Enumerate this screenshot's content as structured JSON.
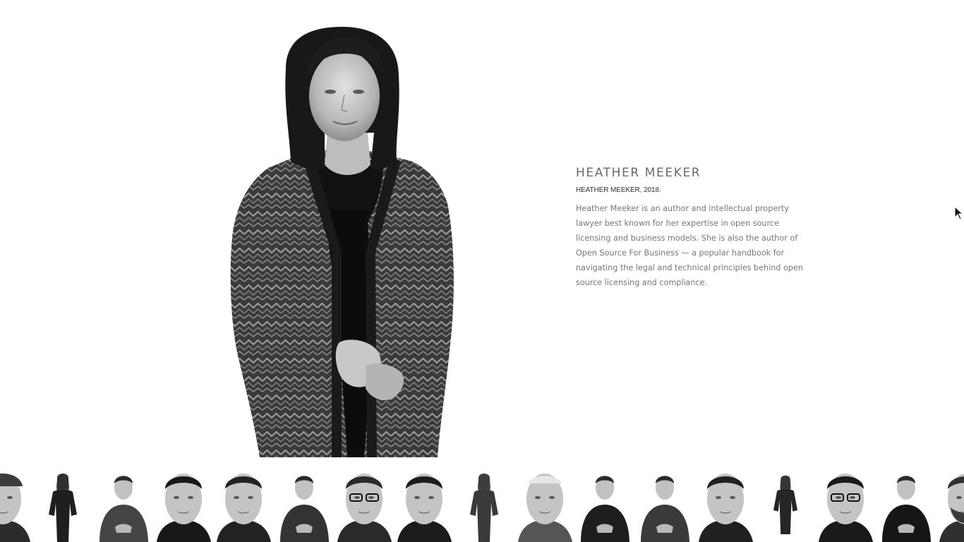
{
  "person": {
    "name": "HEATHER MEEKER",
    "caption": "HEATHER MEEKER, 2018.",
    "description": "Heather Meeker is an author and intellectual property lawyer best known for her expertise in open source licensing and business models. She is also the author of Open Source For Business — a popular handbook for navigating the legal and technical principles behind open source licensing and compliance."
  },
  "thumbnails": [
    {
      "style": "closeup-cap"
    },
    {
      "style": "full-body"
    },
    {
      "style": "half-body"
    },
    {
      "style": "closeup"
    },
    {
      "style": "closeup"
    },
    {
      "style": "half-body"
    },
    {
      "style": "closeup-glasses"
    },
    {
      "style": "closeup"
    },
    {
      "style": "full-body-selected"
    },
    {
      "style": "closeup-old"
    },
    {
      "style": "half-body"
    },
    {
      "style": "half-body"
    },
    {
      "style": "closeup"
    },
    {
      "style": "full-body-small"
    },
    {
      "style": "closeup-glasses"
    },
    {
      "style": "half-body"
    },
    {
      "style": "closeup-beard"
    }
  ],
  "colors": {
    "background": "#ffffff",
    "name_text": "#6a6a6a",
    "body_text": "#777777"
  }
}
